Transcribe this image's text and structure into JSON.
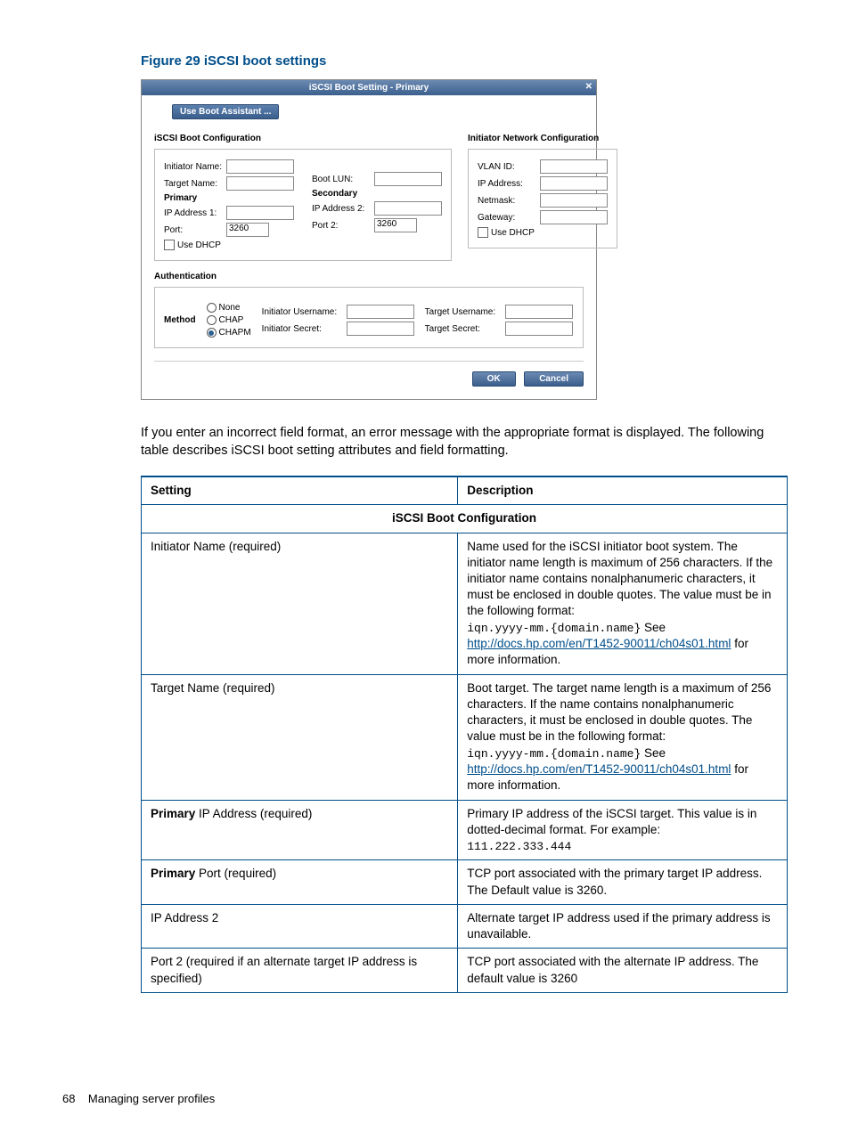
{
  "figure": {
    "title": "Figure 29 iSCSI boot settings"
  },
  "dialog": {
    "title": "iSCSI Boot Setting - Primary",
    "menu": "Use Boot Assistant ...",
    "bootcfg_hdr": "iSCSI Boot Configuration",
    "netcfg_hdr": "Initiator Network Configuration",
    "labels": {
      "initiator_name": "Initiator Name:",
      "target_name": "Target Name:",
      "primary": "Primary",
      "secondary": "Secondary",
      "ip1": "IP Address 1:",
      "ip2": "IP Address 2:",
      "port": "Port:",
      "port2": "Port 2:",
      "boot_lun": "Boot LUN:",
      "use_dhcp": "Use DHCP",
      "vlan": "VLAN ID:",
      "ipaddr": "IP Address:",
      "netmask": "Netmask:",
      "gateway": "Gateway:"
    },
    "values": {
      "port": "3260",
      "port2": "3260"
    },
    "auth": {
      "hdr": "Authentication",
      "method": "Method",
      "none": "None",
      "chap": "CHAP",
      "chapm": "CHAPM",
      "init_user": "Initiator Username:",
      "init_secret": "Initiator Secret:",
      "tgt_user": "Target Username:",
      "tgt_secret": "Target Secret:"
    },
    "ok": "OK",
    "cancel": "Cancel"
  },
  "paragraph": "If you enter an incorrect field format, an error message with the appropriate format is displayed. The following table describes iSCSI boot setting attributes and field formatting.",
  "table": {
    "col1": "Setting",
    "col2": "Description",
    "section": "iSCSI Boot Configuration",
    "rows": [
      {
        "setting": "Initiator Name (required)",
        "desc_pre": "Name used for the iSCSI initiator boot system. The initiator name length is maximum of 256 characters. If the initiator name contains nonalphanumeric characters, it must be enclosed in double quotes. The value must be in the following format:",
        "code": "iqn.yyyy-mm.{domain.name}",
        "see": " See ",
        "link": "http://docs.hp.com/en/T1452-90011/ch04s01.html",
        "desc_post": " for more information."
      },
      {
        "setting": "Target Name (required)",
        "desc_pre": "Boot target. The target name length is a maximum of 256 characters. If the name contains nonalphanumeric characters, it must be enclosed in double quotes. The value must be in the following format:",
        "code": "iqn.yyyy-mm.{domain.name}",
        "see": " See ",
        "link": "http://docs.hp.com/en/T1452-90011/ch04s01.html",
        "desc_post": " for more information."
      },
      {
        "setting_b": "Primary",
        "setting_rest": " IP Address (required)",
        "desc_pre": "Primary IP address of the iSCSI target. This value is in dotted-decimal format. For example:",
        "code": "111.222.333.444"
      },
      {
        "setting_b": "Primary",
        "setting_rest": " Port (required)",
        "desc_pre": "TCP port associated with the primary target IP address. The Default value is 3260."
      },
      {
        "setting": "IP Address 2",
        "desc_pre": "Alternate target IP address used if the primary address is unavailable."
      },
      {
        "setting": "Port 2 (required if an alternate target IP address is specified)",
        "desc_pre": "TCP port associated with the alternate IP address. The default value is 3260"
      }
    ]
  },
  "footer": {
    "page": "68",
    "title": "Managing server profiles"
  }
}
